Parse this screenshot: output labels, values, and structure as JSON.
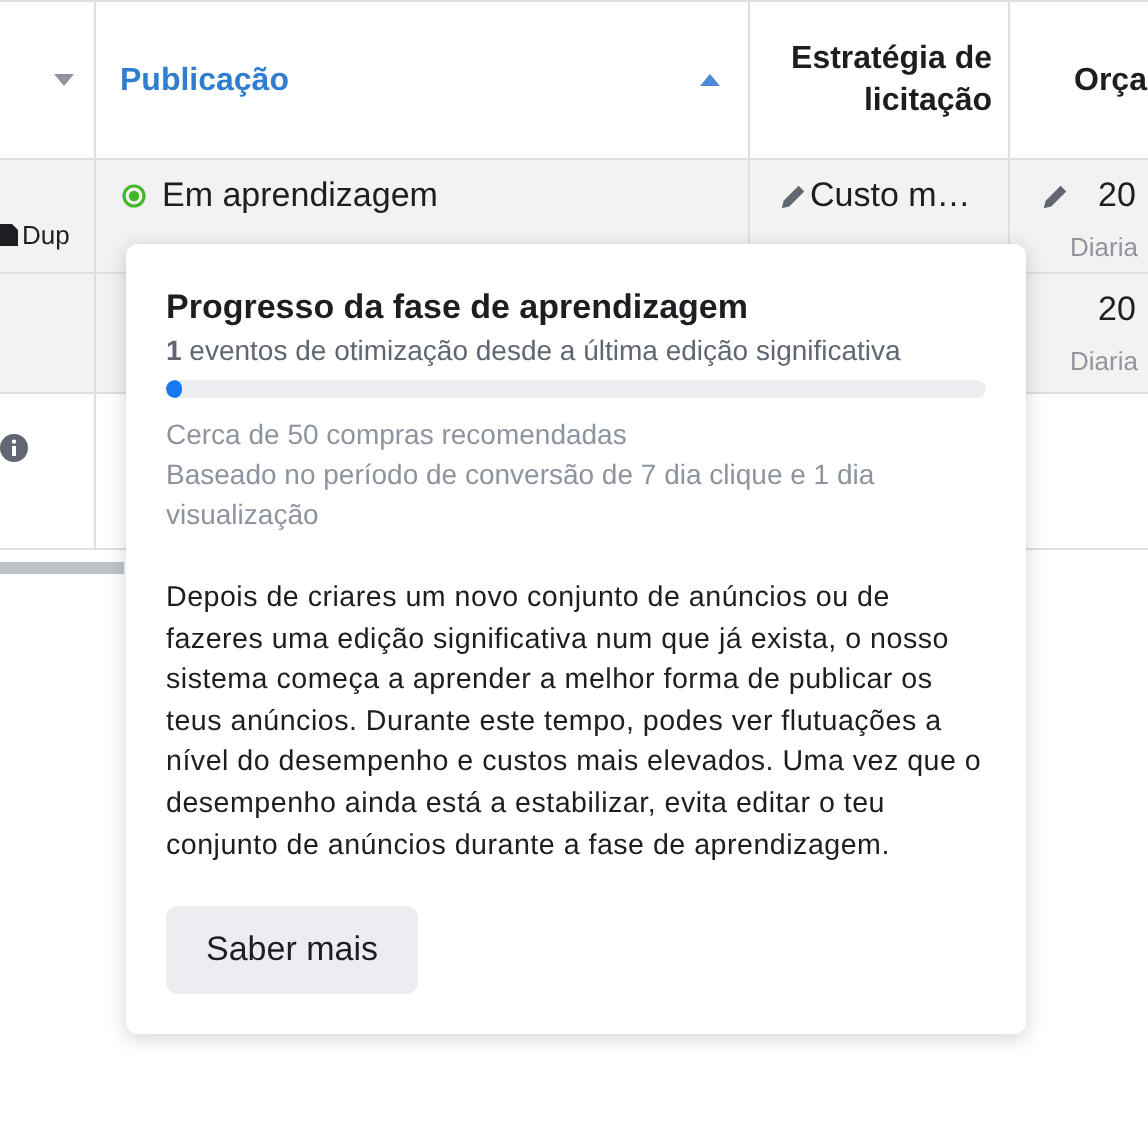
{
  "table": {
    "columns": [
      {
        "kind": "menu"
      },
      {
        "kind": "sortable",
        "label": "Publicação",
        "sorted": true
      },
      {
        "kind": "plain",
        "label": "Estratégia de licitação"
      },
      {
        "kind": "plain",
        "label": "Orça"
      }
    ],
    "rows": [
      {
        "highlighted": true,
        "action": "Dup",
        "status": {
          "label": "Em aprendizagem",
          "color": "#42b72a"
        },
        "bid": {
          "value": "Custo m…",
          "editable": true
        },
        "budget": {
          "value": "20",
          "subtitle": "Diaria",
          "editable": true
        }
      },
      {
        "highlighted": true,
        "budget": {
          "value": "20",
          "subtitle": "Diaria",
          "editable": false
        }
      },
      {
        "highlighted": false,
        "info": true
      }
    ]
  },
  "popover": {
    "title": "Progresso da fase de aprendizagem",
    "progress_text": "**1** eventos de otimização desde a última edição significativa",
    "level": 0.02,
    "notes": [
      "Cerca de 50 compras recomendadas",
      "Baseado no período de conversão de 7 dia clique e 1 dia visualização"
    ],
    "body": "Depois de criares um novo conjunto de anúncios ou de fazeres uma edição significativa num que já exista, o nosso sistema começa a aprender a melhor forma de publicar os teus anúncios. Durante este tempo, podes ver flutuações a nível do desempenho e custos mais elevados. Uma vez que o desempenho ainda está a estabilizar, evita editar o teu conjunto de anúncios durante a fase de aprendizagem.",
    "button": "Saber mais"
  }
}
